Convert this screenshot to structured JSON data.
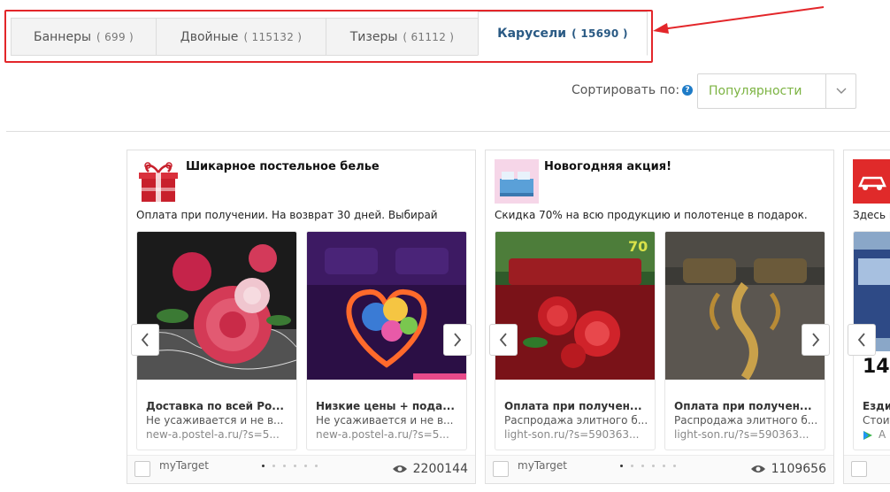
{
  "tabs": [
    {
      "label": "Баннеры",
      "count": "( 699 )",
      "active": false
    },
    {
      "label": "Двойные",
      "count": "( 115132 )",
      "active": false
    },
    {
      "label": "Тизеры",
      "count": "( 61112 )",
      "active": false
    },
    {
      "label": "Карусели",
      "count": "( 15690 )",
      "active": true
    }
  ],
  "sort": {
    "label": "Сортировать по:",
    "help": "?",
    "value": "Популярности"
  },
  "cards": [
    {
      "title": "Шикарное постельное белье",
      "description": "Оплата при получении. На возврат 30 дней. Выбирай",
      "slides": [
        {
          "headline": "Доставка по всей Ро...",
          "text": "Не усаживается и не в...",
          "url": "new-a.postel-a.ru/?s=5..."
        },
        {
          "headline": "Низкие цены + пода...",
          "text": "Не усаживается и не в...",
          "url": "new-a.postel-a.ru/?s=5..."
        }
      ],
      "brand": "myTarget",
      "active_dot": 0,
      "views": "2200144"
    },
    {
      "title": "Новогодняя акция!",
      "description": "Скидка 70% на всю продукцию и полотенце в подарок.",
      "slides": [
        {
          "headline": "Оплата при получен...",
          "text": "Распродажа элитного б...",
          "url": "light-son.ru/?s=590363..."
        },
        {
          "headline": "Оплата при получен...",
          "text": "Распродажа элитного б...",
          "url": "light-son.ru/?s=590363..."
        }
      ],
      "brand": "myTarget",
      "active_dot": 0,
      "views": "1109656"
    },
    {
      "title": "",
      "description": "Здесь п",
      "slides": [
        {
          "headline": "Езди",
          "text": "Стоит",
          "url": "А"
        }
      ],
      "badge": "14"
    }
  ],
  "colors": {
    "highlight": "#e3262a",
    "active_tab": "#2a5a84",
    "sort_value": "#7cb342",
    "help": "#1e7bc7"
  },
  "icons": [
    "chevron-left-icon",
    "chevron-right-icon",
    "chevron-down-icon",
    "eye-icon",
    "help-icon",
    "arrow-annotation"
  ]
}
